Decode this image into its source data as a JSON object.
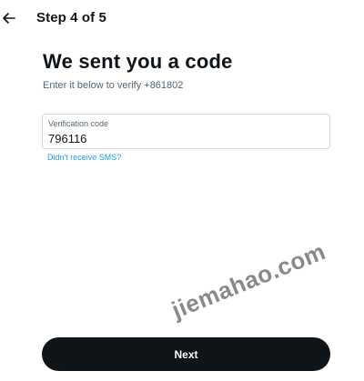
{
  "header": {
    "back_icon": "arrow-left-icon",
    "step_label": "Step 4 of 5"
  },
  "main": {
    "heading": "We sent you a code",
    "subtext": "Enter it below to verify +861802",
    "code_field": {
      "label": "Verification code",
      "value": "796116"
    },
    "resend_link": "Didn't receive SMS?"
  },
  "watermark": "jiemahao.com",
  "footer": {
    "next_label": "Next"
  },
  "colors": {
    "text_primary": "#0f1419",
    "text_secondary": "#536471",
    "link": "#1d9bf0",
    "border": "#cfd9de",
    "button_bg": "#0f1419",
    "button_text": "#ffffff"
  }
}
